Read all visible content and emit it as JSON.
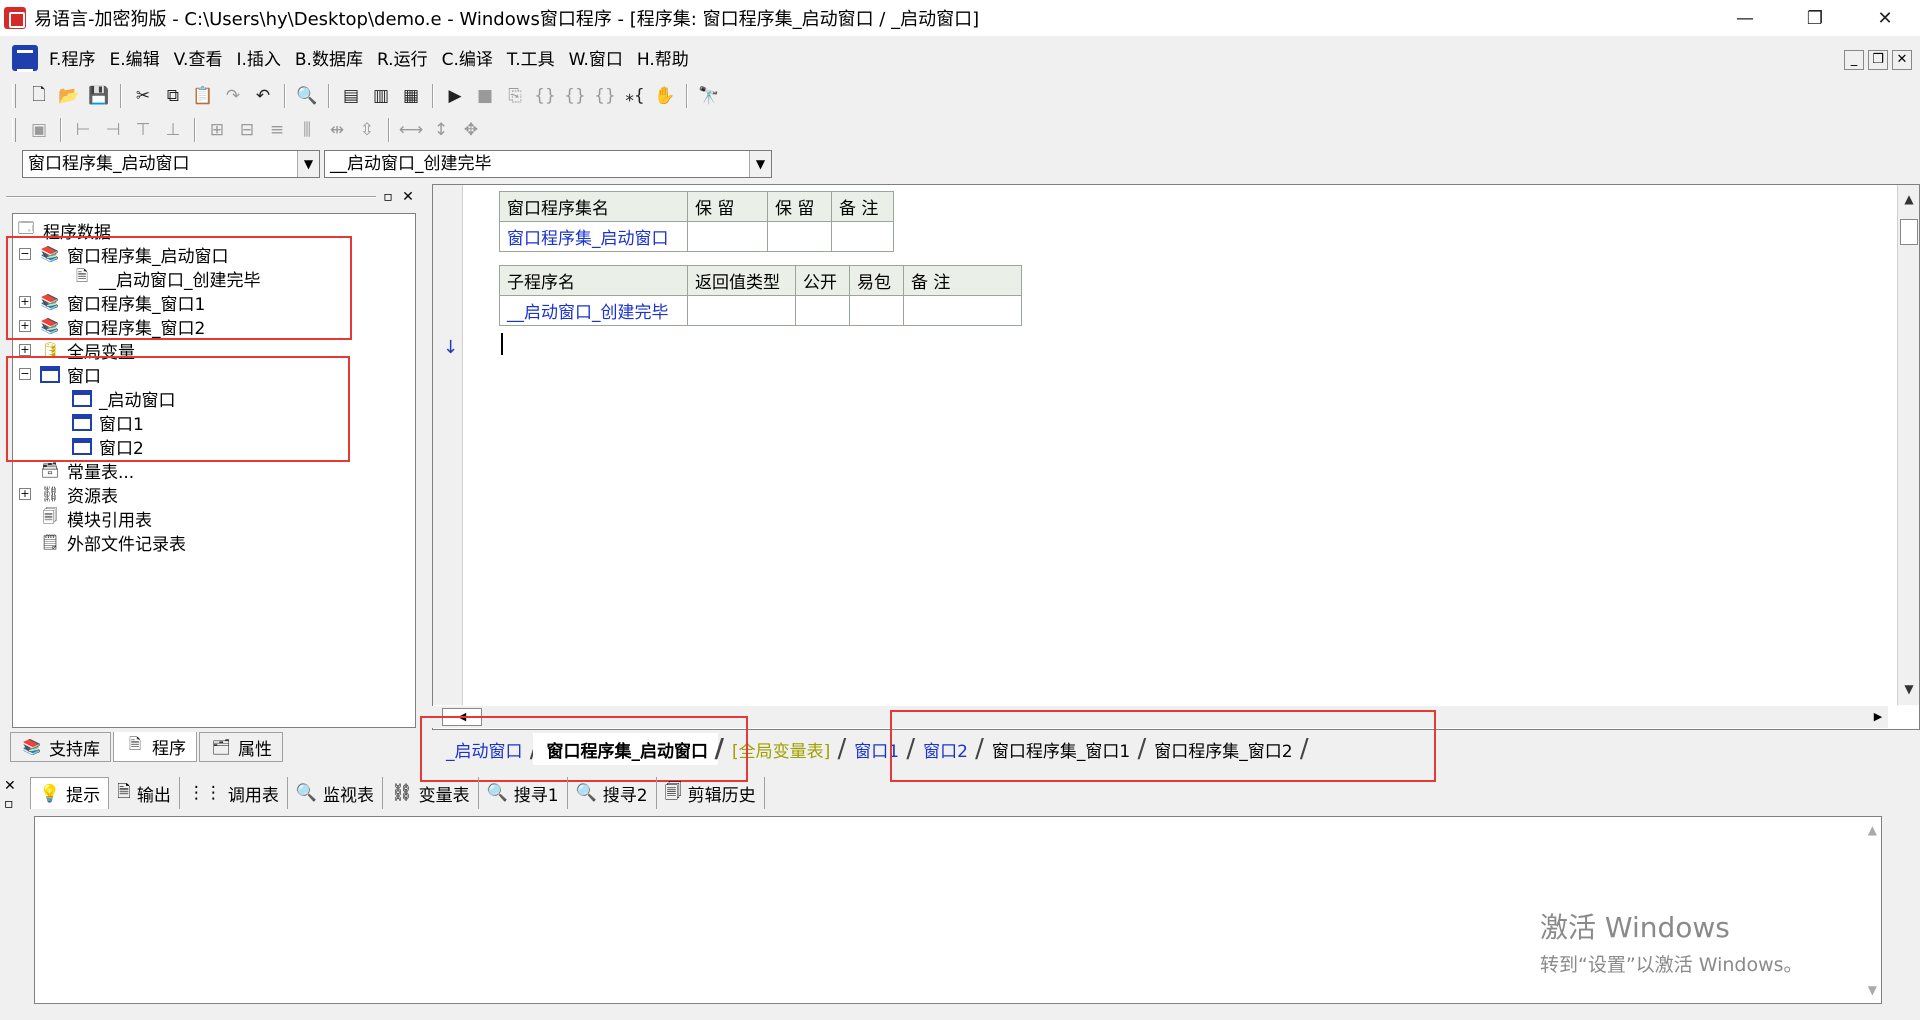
{
  "window": {
    "title": "易语言-加密狗版 - C:\\Users\\hy\\Desktop\\demo.e - Windows窗口程序 - [程序集: 窗口程序集_启动窗口 / _启动窗口]",
    "min": "—",
    "restore": "❐",
    "close": "✕"
  },
  "menu": [
    "F.程序",
    "E.编辑",
    "V.查看",
    "I.插入",
    "B.数据库",
    "R.运行",
    "C.编译",
    "T.工具",
    "W.窗口",
    "H.帮助"
  ],
  "mdi": {
    "min": "_",
    "restore": "❐",
    "close": "✕"
  },
  "combos": {
    "program_set": "窗口程序集_启动窗口",
    "subroutine": "__启动窗口_创建完毕"
  },
  "tree": {
    "root": "程序数据",
    "items": [
      "窗口程序集_启动窗口",
      "__启动窗口_创建完毕",
      "窗口程序集_窗口1",
      "窗口程序集_窗口2",
      "全局变量",
      "窗口",
      "_启动窗口",
      "窗口1",
      "窗口2",
      "常量表...",
      "资源表",
      "模块引用表",
      "外部文件记录表"
    ]
  },
  "left_tabs": [
    "支持库",
    "程序",
    "属性"
  ],
  "table1": {
    "headers": [
      "窗口程序集名",
      "保 留",
      "保 留",
      "备 注"
    ],
    "row": [
      "窗口程序集_启动窗口",
      "",
      "",
      ""
    ]
  },
  "table2": {
    "headers": [
      "子程序名",
      "返回值类型",
      "公开",
      "易包",
      "备 注"
    ],
    "row": [
      "__启动窗口_创建完毕",
      "",
      "",
      "",
      ""
    ]
  },
  "editor_tabs": [
    "_启动窗口",
    "窗口程序集_启动窗口",
    "[全局变量表]",
    "窗口1",
    "窗口2",
    "窗口程序集_窗口1",
    "窗口程序集_窗口2"
  ],
  "bottom_tabs": [
    "提示",
    "输出",
    "调用表",
    "监视表",
    "变量表",
    "搜寻1",
    "搜寻2",
    "剪辑历史"
  ],
  "activation": {
    "title": "激活 Windows",
    "subtitle": "转到“设置”以激活 Windows。"
  },
  "colors": {
    "accent_blue": "#1a33cc",
    "highlight_red": "#e53935",
    "olive": "#a0a000"
  }
}
